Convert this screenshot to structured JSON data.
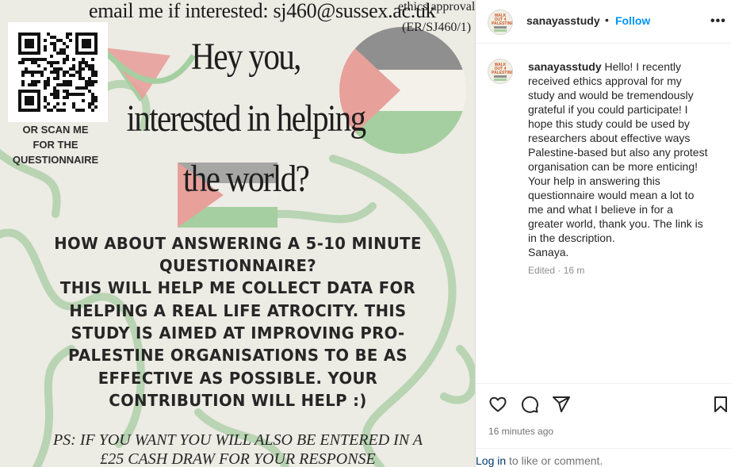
{
  "poster": {
    "email_line": "email me if interested: sj460@sussex.ac.uk",
    "ethics_line1": "ethics approval:",
    "ethics_line2": "(ER/SJ460/1)",
    "scan_lines": [
      "OR SCAN ME",
      "FOR THE",
      "QUESTIONNAIRE"
    ],
    "headline_lines": [
      "Hey you,",
      "interested in helping",
      "the world?"
    ],
    "body_lines": [
      "HOW ABOUT ANSWERING A 5-10 MINUTE",
      "QUESTIONNAIRE?",
      "THIS WILL HELP ME COLLECT DATA FOR",
      "HELPING A REAL LIFE ATROCITY. THIS",
      "STUDY IS AIMED AT IMPROVING PRO-",
      "PALESTINE ORGANISATIONS TO BE AS",
      "EFFECTIVE AS POSSIBLE. YOUR",
      "CONTRIBUTION WILL HELP :)"
    ],
    "ps_lines": [
      "PS: IF YOU WANT YOU WILL ALSO BE ENTERED IN A",
      "£25 CASH DRAW FOR YOUR RESPONSE"
    ],
    "colors": {
      "flag_red": "#e8a09a",
      "flag_green": "#a5cfa0",
      "flag_black": "#8f8f8f",
      "swirl_green": "#8fc28a"
    }
  },
  "header": {
    "username": "sanayasstudy",
    "dot": "•",
    "follow_label": "Follow",
    "more_icon": "more-horizontal-icon",
    "more_label": "•••"
  },
  "avatar_text": "WALK OUT 4 PALESTINE",
  "caption": {
    "username": "sanayasstudy",
    "lines": [
      "Hello! I recently",
      "received ethics approval for my",
      "study and would be tremendously",
      "grateful if you could participate! I",
      "hope this study could be used by",
      "researchers about effective ways",
      "Palestine-based but also any protest",
      "organisation can be more enticing!",
      "Your help in answering this",
      "questionnaire would mean a lot to",
      "me and what I believe in for a",
      "greater world, thank you. The link is",
      "in the description.",
      "Sanaya."
    ],
    "edited": "Edited · 16 m"
  },
  "actions": {
    "icons": [
      "heart-icon",
      "comment-icon",
      "share-icon",
      "bookmark-icon"
    ]
  },
  "timestamp": "16 minutes ago",
  "login": {
    "link": "Log in",
    "rest": " to like or comment."
  }
}
